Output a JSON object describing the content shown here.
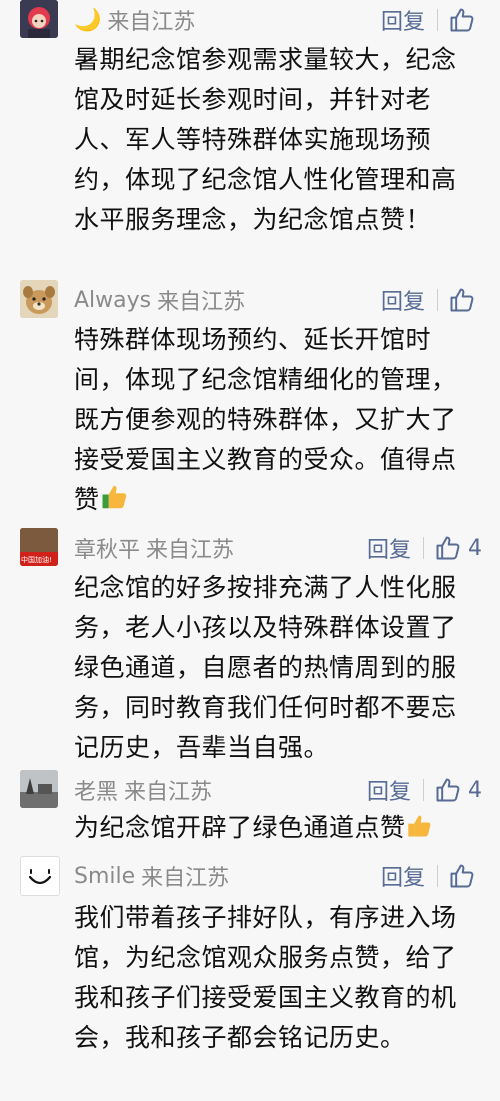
{
  "comments": [
    {
      "nickname": "🌙",
      "location": "来自江苏",
      "reply_label": "回复",
      "like_count": "",
      "avatar_icon": "red-hair-character-avatar",
      "text": "暑期纪念馆参观需求量较大，纪念馆及时延长参观时间，并针对老人、军人等特殊群体实施现场预约，体现了纪念馆人性化管理和高水平服务理念，为纪念馆点赞！"
    },
    {
      "nickname": "Always",
      "location": "来自江苏",
      "reply_label": "回复",
      "like_count": "",
      "avatar_icon": "plush-dog-avatar",
      "text": "特殊群体现场预约、延长开馆时间，体现了纪念馆精细化的管理，既方便参观的特殊群体，又扩大了接受爱国主义教育的受众。值得点赞"
    },
    {
      "nickname": "章秋平",
      "location": "来自江苏",
      "reply_label": "回复",
      "like_count": "4",
      "avatar_icon": "china-flag-avatar",
      "avatar_text": "中国加油!",
      "text": "纪念馆的好多按排充满了人性化服务，老人小孩以及特殊群体设置了绿色通道，自愿者的热情周到的服务，同时教育我们任何时都不要忘记历史，吾辈当自强。"
    },
    {
      "nickname": "老黑",
      "location": "来自江苏",
      "reply_label": "回复",
      "like_count": "4",
      "avatar_icon": "landscape-photo-avatar",
      "text": "为纪念馆开辟了绿色通道点赞"
    },
    {
      "nickname": "Smile",
      "location": "来自江苏",
      "reply_label": "回复",
      "like_count": "",
      "avatar_icon": "smile-face-avatar",
      "text": "我们带着孩子排好队，有序进入场馆，为纪念馆观众服务点赞，给了我和孩子们接受爱国主义教育的机会，我和孩子都会铭记历史。"
    }
  ],
  "colors": {
    "link": "#576b95",
    "meta": "#8a8a8a",
    "text": "#111111",
    "background": "#f7f7f7"
  }
}
